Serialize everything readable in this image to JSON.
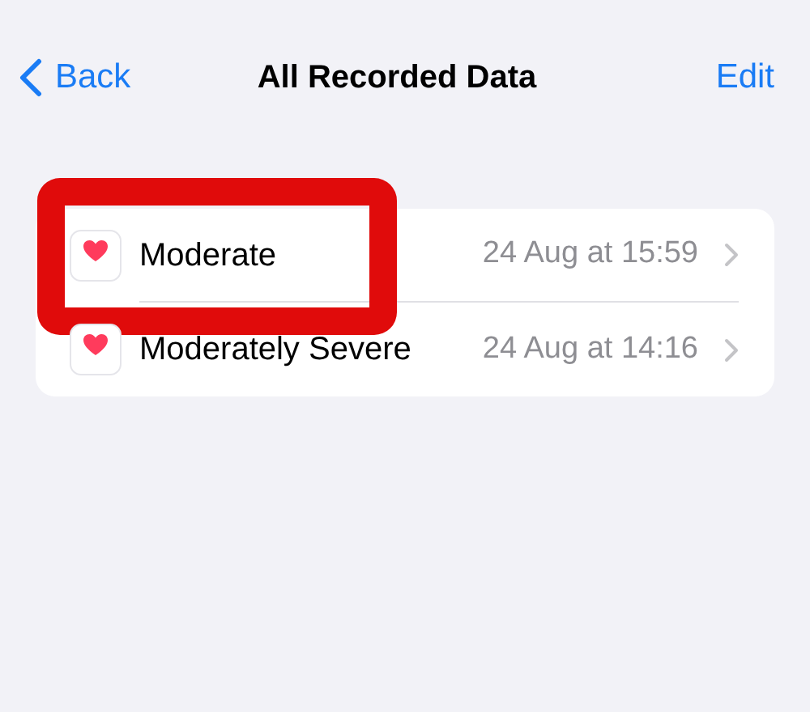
{
  "nav": {
    "back": "Back",
    "title": "All Recorded Data",
    "edit": "Edit"
  },
  "rows": [
    {
      "label": "Moderate",
      "date": "24 Aug at 15:59",
      "highlighted": true
    },
    {
      "label": "Moderately Severe",
      "date": "24 Aug at 14:16",
      "highlighted": false
    }
  ]
}
